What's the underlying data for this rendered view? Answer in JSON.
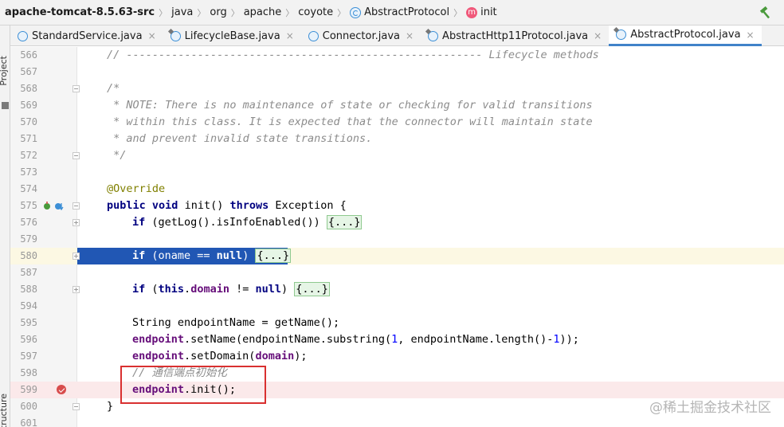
{
  "breadcrumb": [
    {
      "label": "apache-tomcat-8.5.63-src",
      "icon": "none"
    },
    {
      "label": "java",
      "icon": "none"
    },
    {
      "label": "org",
      "icon": "none"
    },
    {
      "label": "apache",
      "icon": "none"
    },
    {
      "label": "coyote",
      "icon": "none"
    },
    {
      "label": "AbstractProtocol",
      "icon": "class-icon"
    },
    {
      "label": "init",
      "icon": "method-icon",
      "glyph": "m"
    }
  ],
  "sidebar": {
    "project_label": "Project",
    "structure_label": "Structure"
  },
  "tabs": [
    {
      "label": "StandardService.java",
      "active": false,
      "close": "×"
    },
    {
      "label": "LifecycleBase.java",
      "active": false,
      "close": "×"
    },
    {
      "label": "Connector.java",
      "active": false,
      "close": "×"
    },
    {
      "label": "AbstractHttp11Protocol.java",
      "active": false,
      "close": "×"
    },
    {
      "label": "AbstractProtocol.java",
      "active": true,
      "close": "×"
    }
  ],
  "lines": {
    "l566": {
      "num": "566",
      "text": "// ------------------------------------------------------- Lifecycle methods"
    },
    "l567": {
      "num": "567"
    },
    "l568": {
      "num": "568",
      "text": "/*"
    },
    "l569": {
      "num": "569",
      "text": " * NOTE: There is no maintenance of state or checking for valid transitions"
    },
    "l570": {
      "num": "570",
      "text": " * within this class. It is expected that the connector will maintain state"
    },
    "l571": {
      "num": "571",
      "text": " * and prevent invalid state transitions."
    },
    "l572": {
      "num": "572",
      "text": " */"
    },
    "l573": {
      "num": "573"
    },
    "l574": {
      "num": "574",
      "text": "@Override"
    },
    "l575": {
      "num": "575",
      "k1": "public",
      "k2": "void",
      "mid": " init() ",
      "k3": "throws",
      "rest": " Exception {"
    },
    "l576": {
      "num": "576",
      "k1": "if",
      "mid": " (getLog().isInfoEnabled()) ",
      "fold": "{...}"
    },
    "l579": {
      "num": "579"
    },
    "l580": {
      "num": "580",
      "k1": "if",
      "mid": " (oname == ",
      "k2": "null",
      "rest": ") ",
      "fold": "{...}"
    },
    "l587": {
      "num": "587"
    },
    "l588": {
      "num": "588",
      "k1": "if",
      "mid": " (",
      "k2": "this",
      "p1": ".",
      "f1": "domain",
      "mid2": " != ",
      "k3": "null",
      "rest": ") ",
      "fold": "{...}"
    },
    "l594": {
      "num": "594"
    },
    "l595": {
      "num": "595",
      "text": "String endpointName = getName();"
    },
    "l596": {
      "num": "596",
      "f1": "endpoint",
      "mid": ".setName(endpointName.substring(",
      "n1": "1",
      "mid2": ", endpointName.length()-",
      "n2": "1",
      "rest": "));"
    },
    "l597": {
      "num": "597",
      "f1": "endpoint",
      "mid": ".setDomain(",
      "f2": "domain",
      "rest": ");"
    },
    "l598": {
      "num": "598",
      "text": "// 通信端点初始化"
    },
    "l599": {
      "num": "599",
      "f1": "endpoint",
      "rest": ".init();"
    },
    "l600": {
      "num": "600",
      "text": "}"
    },
    "l601": {
      "num": "601"
    }
  },
  "watermark": "@稀土掘金技术社区",
  "colors": {
    "keyword": "#000080",
    "field": "#660e7a",
    "comment": "#8c8c8c",
    "annotation": "#808000",
    "selection": "#2157b4",
    "highlight_box": "#d93030"
  }
}
